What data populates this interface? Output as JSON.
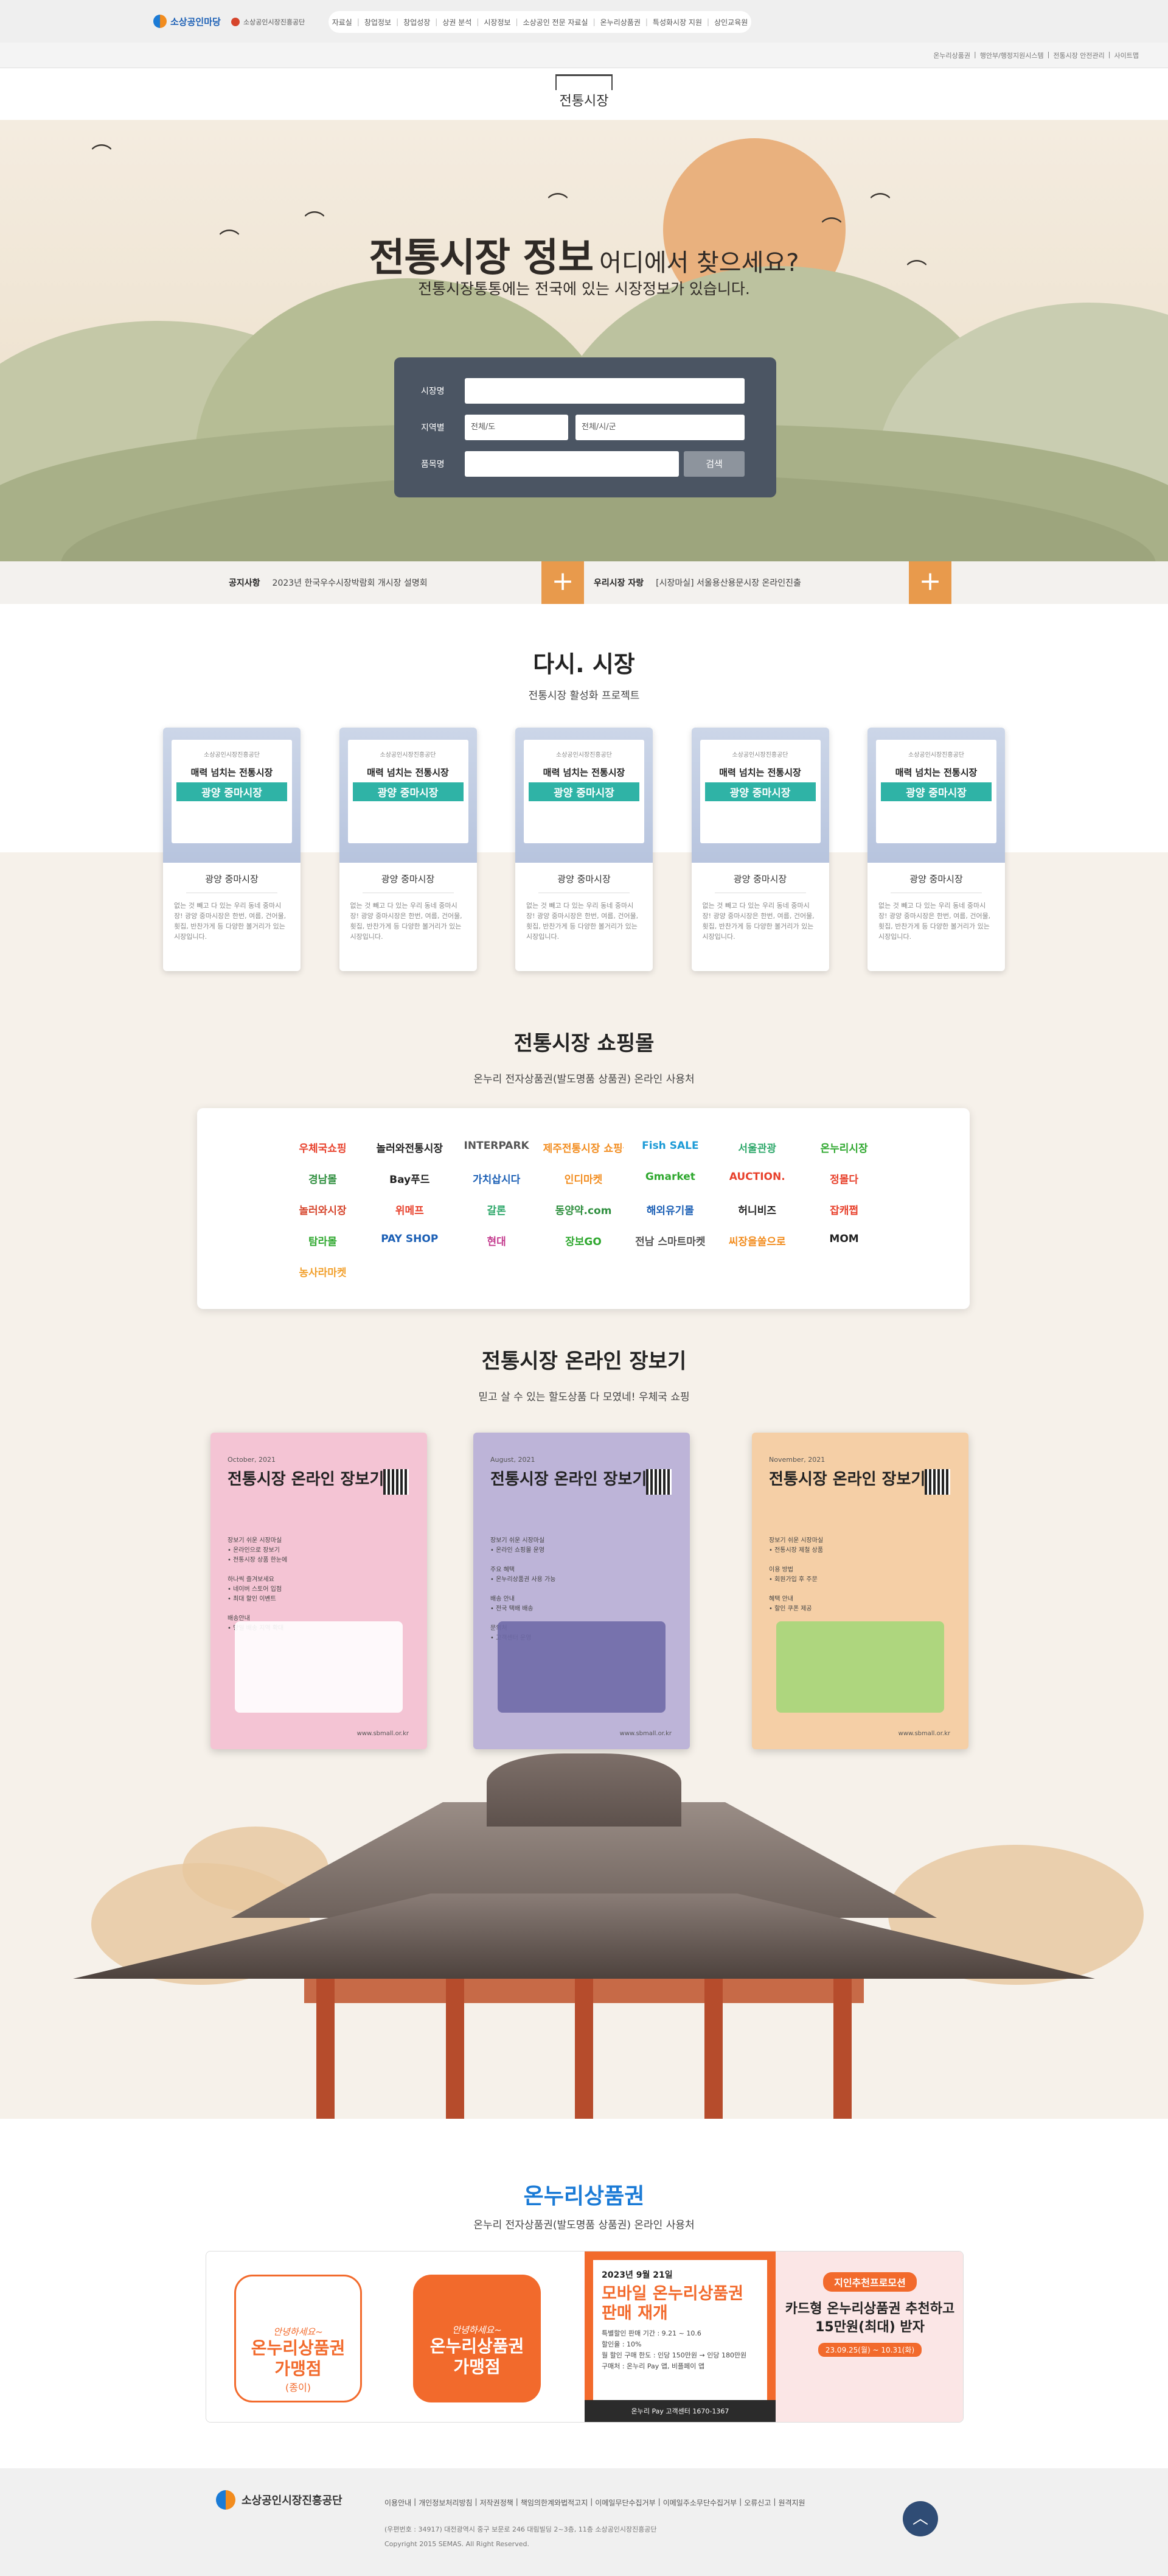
{
  "header": {
    "logo_main": "소상공인마당",
    "logo_sub": "소상공인시장진흥공단",
    "top_links": [
      "자료실",
      "창업정보",
      "창업성장",
      "상권 분석",
      "시장정보",
      "소상공인 전문 자료실",
      "온누리상품권",
      "특성화시장 지원",
      "상인교육원"
    ],
    "sub_links": [
      "온누리상품권",
      "행안부/행정지원시스템",
      "전통시장 안전관리",
      "사이트맵"
    ],
    "brand": "전통시장"
  },
  "hero": {
    "title_big": "전통시장 정보",
    "title_mid": "어디에서 찾으세요?",
    "subtitle": "전통시장통통에는 전국에 있는 시장정보가 있습니다.",
    "search": {
      "market_label": "시장명",
      "region_label": "지역별",
      "region_select1": "전체/도",
      "region_select2": "전체/시/군",
      "item_label": "품목명",
      "search_button": "검색"
    }
  },
  "notice": {
    "notice_label": "공지사항",
    "notice_text": "2023년 한국우수시장박람회 개시장 설명회",
    "market_label": "우리시장 자랑",
    "market_text": "[시장마실] 서울용산용문시장 온라인진출"
  },
  "section_markets": {
    "title": "다시. 시장",
    "subtitle": "전통시장 활성화 프로젝트",
    "cards": [
      {
        "poster_top": "소상공인시장진흥공단",
        "poster_head": "매력 넘치는 전통시장",
        "poster_name": "광양 중마시장",
        "name": "광양 중마시장",
        "desc": "없는 것 빼고 다 있는 우리 동네 중마시장! 광양 중마시장은 한번, 여름, 건어물, 횟집, 반찬가게 등 다양한 볼거리가 있는 시장입니다."
      },
      {
        "poster_top": "소상공인시장진흥공단",
        "poster_head": "매력 넘치는 전통시장",
        "poster_name": "광양 중마시장",
        "name": "광양 중마시장",
        "desc": "없는 것 빼고 다 있는 우리 동네 중마시장! 광양 중마시장은 한번, 여름, 건어물, 횟집, 반찬가게 등 다양한 볼거리가 있는 시장입니다."
      },
      {
        "poster_top": "소상공인시장진흥공단",
        "poster_head": "매력 넘치는 전통시장",
        "poster_name": "광양 중마시장",
        "name": "광양 중마시장",
        "desc": "없는 것 빼고 다 있는 우리 동네 중마시장! 광양 중마시장은 한번, 여름, 건어물, 횟집, 반찬가게 등 다양한 볼거리가 있는 시장입니다."
      },
      {
        "poster_top": "소상공인시장진흥공단",
        "poster_head": "매력 넘치는 전통시장",
        "poster_name": "광양 중마시장",
        "name": "광양 중마시장",
        "desc": "없는 것 빼고 다 있는 우리 동네 중마시장! 광양 중마시장은 한번, 여름, 건어물, 횟집, 반찬가게 등 다양한 볼거리가 있는 시장입니다."
      },
      {
        "poster_top": "소상공인시장진흥공단",
        "poster_head": "매력 넘치는 전통시장",
        "poster_name": "광양 중마시장",
        "name": "광양 중마시장",
        "desc": "없는 것 빼고 다 있는 우리 동네 중마시장! 광양 중마시장은 한번, 여름, 건어물, 횟집, 반찬가게 등 다양한 볼거리가 있는 시장입니다."
      }
    ]
  },
  "section_mall": {
    "title": "전통시장 쇼핑몰",
    "subtitle": "온누리 전자상품권(발도명품 상품권) 온라인 사용처",
    "logos": [
      {
        "name": "우체국쇼핑",
        "color": "#e8412c"
      },
      {
        "name": "놀러와전통시장",
        "color": "#222222"
      },
      {
        "name": "INTERPARK",
        "color": "#555555"
      },
      {
        "name": "제주전통시장 쇼핑몰",
        "color": "#f28c1e"
      },
      {
        "name": "Fish SALE",
        "color": "#1b9ad6"
      },
      {
        "name": "서울관광",
        "color": "#2fa86b"
      },
      {
        "name": "온누리시장",
        "color": "#2fa82f"
      },
      {
        "name": "경남몰",
        "color": "#2f8f3f"
      },
      {
        "name": "Bay푸드",
        "color": "#222222"
      },
      {
        "name": "가치삽시다",
        "color": "#1b5fb5"
      },
      {
        "name": "인디마켓",
        "color": "#f28c1e"
      },
      {
        "name": "Gmarket",
        "color": "#2fa82f"
      },
      {
        "name": "AUCTION.",
        "color": "#e8412c"
      },
      {
        "name": "정몰다",
        "color": "#e8412c"
      },
      {
        "name": "놀러와시장",
        "color": "#d6452c"
      },
      {
        "name": "위메프",
        "color": "#e8412c"
      },
      {
        "name": "갈론",
        "color": "#2fa86b"
      },
      {
        "name": "동양약.com",
        "color": "#2f8f3f"
      },
      {
        "name": "해외유기몰",
        "color": "#1b5fb5"
      },
      {
        "name": "허니비즈",
        "color": "#222222"
      },
      {
        "name": "잡캐쩝",
        "color": "#e8412c"
      },
      {
        "name": "탐라몰",
        "color": "#2fa82f"
      },
      {
        "name": "PAY SHOP",
        "color": "#1b5fb5"
      },
      {
        "name": "현대",
        "color": "#c43c8f"
      },
      {
        "name": "장보GO",
        "color": "#2fa82f"
      },
      {
        "name": "전남 스마트마켓",
        "color": "#555555"
      },
      {
        "name": "씨장을쏠으로",
        "color": "#f28c1e"
      },
      {
        "name": "MOM",
        "color": "#222222"
      },
      {
        "name": "농사라마켓",
        "color": "#f2a02c"
      }
    ]
  },
  "section_online": {
    "title": "전통시장 온라인 장보기",
    "subtitle": "믿고 살 수 있는 할도상품 다 모였네! 우체국 쇼핑",
    "posters": [
      {
        "date": "October, 2021",
        "title": "전통시장 온라인 장보기",
        "body": "장보기 쉬운 시장마실\n• 온라인으로 장보기\n• 전통시장 상품 한눈에\n\n하나씩 즐겨보세요\n• 네이버 스토어 입점\n• 최대 할인 이벤트\n\n배송안내\n• 당일 배송 지역 확대",
        "url": "www.sbmall.or.kr",
        "bg": "#f4c4d4",
        "art": "#ffffff"
      },
      {
        "date": "August, 2021",
        "title": "전통시장 온라인 장보기",
        "body": "장보기 쉬운 시장마실\n• 온라인 쇼핑몰 운영\n\n주요 혜택\n• 온누리상품권 사용 가능\n\n배송 안내\n• 전국 택배 배송\n\n문의처\n• 고객센터 운영",
        "url": "www.sbmall.or.kr",
        "bg": "#bdb4d8",
        "art": "#6f6aa8"
      },
      {
        "date": "November, 2021",
        "title": "전통시장 온라인 장보기",
        "body": "장보기 쉬운 시장마실\n• 전통시장 제철 상품\n\n이용 방법\n• 회원가입 후 주문\n\n혜택 안내\n• 할인 쿠폰 제공",
        "url": "www.sbmall.or.kr",
        "bg": "#f5cfa6",
        "art": "#a6d67a"
      }
    ]
  },
  "section_onnuri": {
    "title": "온누리상품권",
    "subtitle": "온누리 전자상품권(발도명품 상품권) 온라인 사용처",
    "tag1_small": "안녕하세요~",
    "tag1_big": "온누리상품권\n가맹점",
    "tag1_note": "(종이)",
    "tag2_small": "안녕하세요~",
    "tag2_big": "온누리상품권\n가맹점",
    "banner1_date": "2023년 9월 21일",
    "banner1_title": "모바일 온누리상품권\n판매 재개",
    "banner1_text": "특별할인 판매 기간 : 9.21 ~ 10.6\n할인율 : 10%\n월 할인 구매 한도 : 인당 150만원 → 인당 180만원\n구매처 : 온누리 Pay 앱, 비플페이 앱",
    "banner1_footer": "온누리 Pay 고객센터 1670-1367",
    "banner2_tag": "지인추천프로모션",
    "banner2_title": "카드형 온누리상품권 추천하고\n15만원(최대) 받자",
    "banner2_period": "23.09.25(월) ~ 10.31(화)"
  },
  "footer": {
    "logo": "소상공인시장진흥공단",
    "links": [
      "이용안내",
      "개인정보처리방침",
      "저작권정책",
      "책임의한계와법적고지",
      "이메일무단수집거부",
      "이메일주소무단수집거부",
      "오류신고",
      "원격지원"
    ],
    "address": "(우편번호 : 34917) 대전광역시 중구 보문로 246 대림빌딩 2~3층, 11층 소상공인시장진흥공단",
    "copyright": "Copyright 2015 SEMAS. All Right Reserved."
  }
}
